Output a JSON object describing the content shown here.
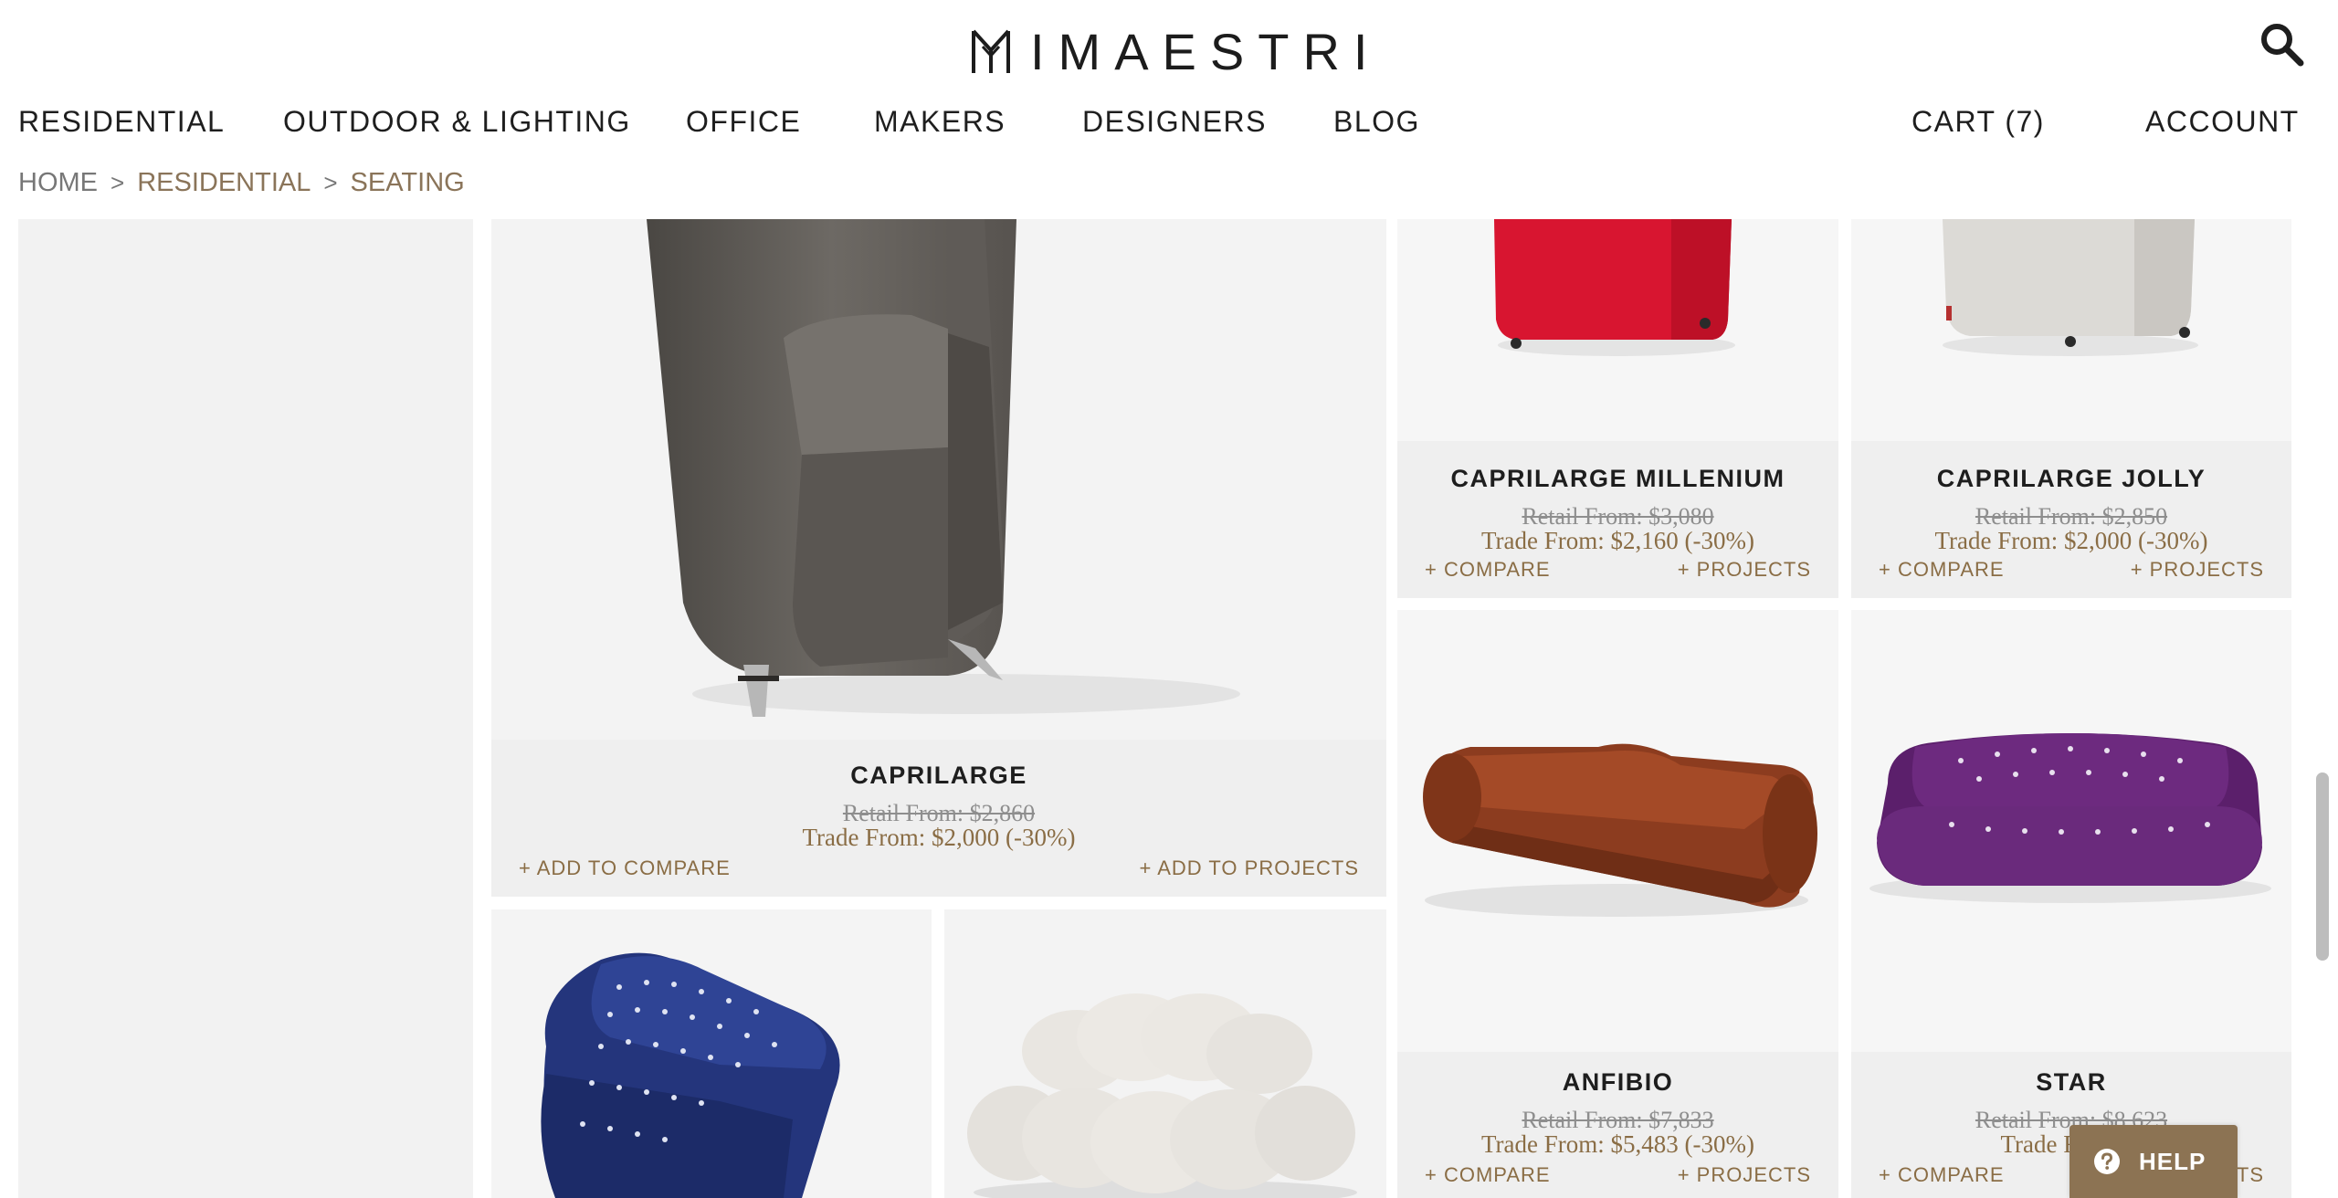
{
  "brand": {
    "name": "IMAESTRI"
  },
  "header": {
    "search_icon": "search-icon"
  },
  "nav": {
    "residential": "RESIDENTIAL",
    "outdoor_lighting": "OUTDOOR & LIGHTING",
    "office": "OFFICE",
    "makers": "MAKERS",
    "designers": "DESIGNERS",
    "blog": "BLOG",
    "cart": "CART (7)",
    "account": "ACCOUNT"
  },
  "breadcrumb": {
    "home": "HOME",
    "residential": "RESIDENTIAL",
    "current": "SEATING",
    "separator": ">"
  },
  "products": {
    "caprilarge": {
      "name": "CAPRILARGE",
      "retail": "Retail From: $2,860",
      "trade": "Trade From: $2,000 (-30%)",
      "compare": "+ ADD TO COMPARE",
      "projects": "+ ADD TO PROJECTS",
      "image": "dark grey wool high-back armchair"
    },
    "millenium": {
      "name": "CAPRILARGE MILLENIUM",
      "retail": "Retail From: $3,080",
      "trade": "Trade From: $2,160 (-30%)",
      "compare": "+ COMPARE",
      "projects": "+ PROJECTS",
      "image": "red armchair on casters"
    },
    "jolly": {
      "name": "CAPRILARGE JOLLY",
      "retail": "Retail From: $2,850",
      "trade": "Trade From: $2,000 (-30%)",
      "compare": "+ COMPARE",
      "projects": "+ PROJECTS",
      "image": "white armchair on casters"
    },
    "anfibio": {
      "name": "ANFIBIO",
      "retail": "Retail From: $7,833",
      "trade": "Trade From: $5,483 (-30%)",
      "compare": "+ COMPARE",
      "projects": "+ PROJECTS",
      "image": "brown leather sofa"
    },
    "star": {
      "name": "STAR",
      "retail": "Retail From: $8,623",
      "trade": "Trade From: $",
      "compare": "+ COMPARE",
      "projects": "TS",
      "image": "purple tufted sofa"
    },
    "blue": {
      "image": "blue tufted armchair"
    },
    "cloud": {
      "image": "white cloud sofa"
    }
  },
  "help": {
    "label": "HELP",
    "icon": "question-icon"
  },
  "colors": {
    "accent": "#8a6d45",
    "help_bg": "#8c7353",
    "panel": "#f1f1f1"
  }
}
